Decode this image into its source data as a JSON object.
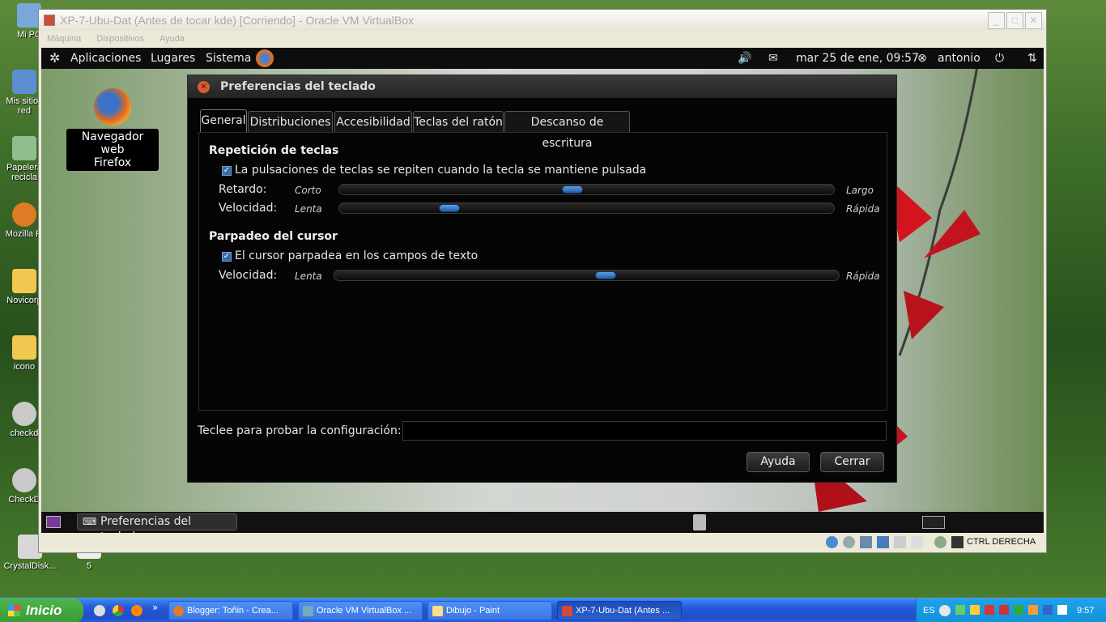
{
  "desktop": {
    "icons": [
      {
        "label": "Mi PC"
      },
      {
        "label": "Mis sitios red"
      },
      {
        "label": "Papelera recicla"
      },
      {
        "label": "Mozilla Fi"
      },
      {
        "label": "Novicorp"
      },
      {
        "label": "icono"
      },
      {
        "label": "checkd"
      },
      {
        "label": "CheckD"
      },
      {
        "label": "CrystalDisk..."
      },
      {
        "label": "5"
      }
    ]
  },
  "vbox": {
    "title": "XP-7-Ubu-Dat (Antes de tocar kde) [Corriendo] - Oracle VM VirtualBox",
    "menu": [
      "Máquina",
      "Dispositivos",
      "Ayuda"
    ],
    "status_host_key": "CTRL DERECHA"
  },
  "guest": {
    "top_panel": {
      "menu_apps": "Aplicaciones",
      "menu_places": "Lugares",
      "menu_system": "Sistema",
      "clock": "mar 25 de ene, 09:57",
      "user": "antonio"
    },
    "desktop_icon": {
      "line1": "Navegador web",
      "line2": "Firefox"
    },
    "bottom_panel": {
      "task": "Preferencias del teclado"
    }
  },
  "dialog": {
    "title": "Preferencias del teclado",
    "tabs": [
      "General",
      "Distribuciones",
      "Accesibilidad",
      "Teclas del ratón",
      "Descanso de escritura"
    ],
    "key_repeat": {
      "heading": "Repetición de teclas",
      "checkbox": "La pulsaciones de teclas se repiten cuando la tecla se mantiene pulsada",
      "delay_label": "Retardo:",
      "delay_min": "Corto",
      "delay_max": "Largo",
      "delay_value": 0.47,
      "speed_label": "Velocidad:",
      "speed_min": "Lenta",
      "speed_max": "Rápida",
      "speed_value": 0.21
    },
    "cursor_blink": {
      "heading": "Parpadeo del cursor",
      "checkbox": "El cursor parpadea en los campos de texto",
      "speed_label": "Velocidad:",
      "speed_min": "Lenta",
      "speed_max": "Rápida",
      "speed_value": 0.54
    },
    "test_label": "Teclee para probar la configuración:",
    "help_button": "Ayuda",
    "close_button": "Cerrar"
  },
  "taskbar": {
    "start": "Inicio",
    "tasks": [
      {
        "label": "Blogger: Toñin - Crea..."
      },
      {
        "label": "Oracle VM VirtualBox ..."
      },
      {
        "label": "Dibujo - Paint"
      },
      {
        "label": "XP-7-Ubu-Dat (Antes ..."
      }
    ],
    "lang": "ES",
    "clock": "9:57"
  }
}
